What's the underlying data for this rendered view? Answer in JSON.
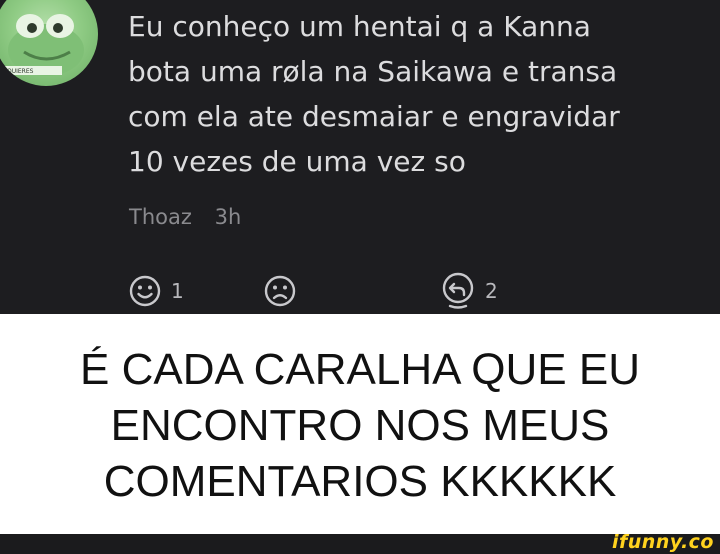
{
  "comment": {
    "text": "Eu conheço um hentai q a Kanna\nbota uma røla na Saikawa e transa\ncom ela ate desmaiar e engravidar\n10 vezes de uma vez so",
    "author": "Thoaz",
    "time": "3h",
    "likes_count": "1",
    "replies_count": "2",
    "avatar_caption": "QUIERES",
    "colors": {
      "background": "#1d1d20",
      "text": "#dcdcde",
      "meta": "#8a8a8e"
    }
  },
  "caption": {
    "text": "É CADA CARALHA QUE EU\nENCONTRO NOS MEUS\nCOMENTARIOS KKKKKK"
  },
  "watermark": {
    "text": "ifunny.co",
    "color": "#ffd21e"
  }
}
